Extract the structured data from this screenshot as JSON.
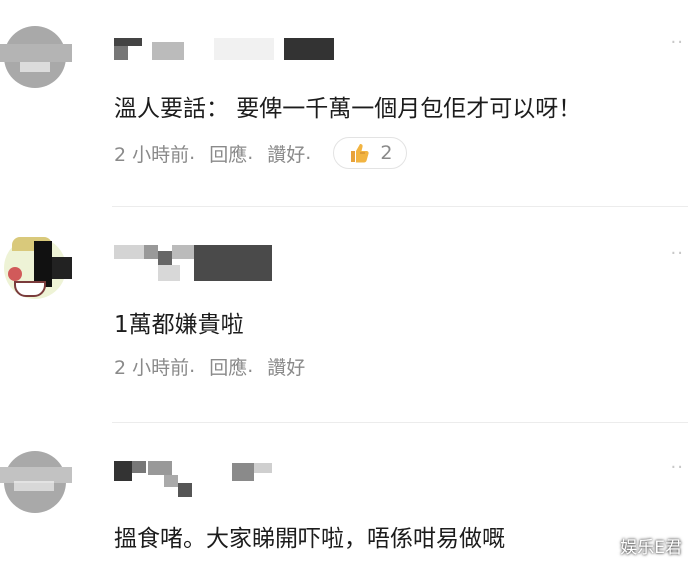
{
  "comments": [
    {
      "text": "溫人要話： 要俾一千萬一個月包佢才可以呀！",
      "time": "2 小時前",
      "reply": "回應",
      "like": "讚好",
      "like_count": "2",
      "more": "··"
    },
    {
      "text": "1萬都嫌貴啦",
      "time": "2 小時前",
      "reply": "回應",
      "like": "讚好",
      "more": "··"
    },
    {
      "text": "搵食啫。大家睇開吓啦，唔係咁易做嘅",
      "more": "··"
    }
  ],
  "separator": ".",
  "watermark": "娱乐E君",
  "colors": {
    "meta": "#8a8a8a",
    "divider": "#ececec",
    "thumb": "#e8a23a"
  },
  "icons": {
    "like": "thumbs-up-icon",
    "more": "more-dots-icon"
  }
}
